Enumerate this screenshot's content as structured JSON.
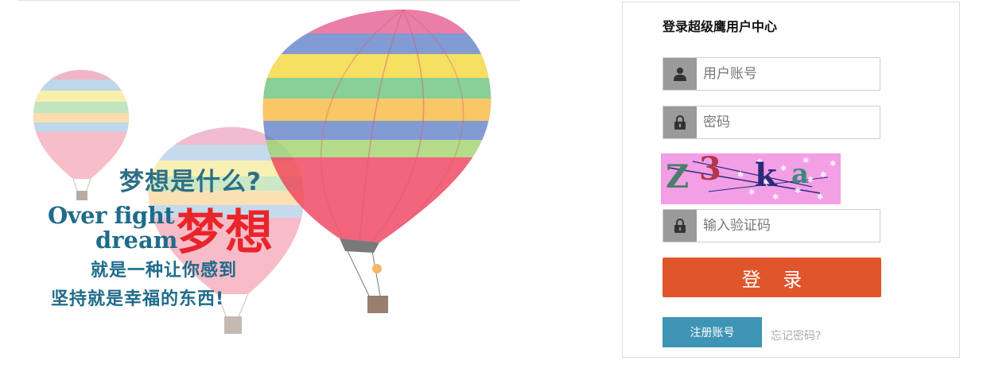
{
  "banner": {
    "question": "梦想是什么?",
    "en_line1": "Over fight",
    "en_line2": "dream",
    "dream_cn": "梦想",
    "line3": "就是一种让你感到",
    "line4": "坚持就是幸福的东西!",
    "colors": {
      "teal": "#1f6b8a",
      "red": "#e8252b"
    }
  },
  "login": {
    "title": "登录超级鹰用户中心",
    "username": {
      "placeholder": "用户账号",
      "value": "",
      "icon": "user-icon"
    },
    "password": {
      "placeholder": "密码",
      "value": "",
      "icon": "lock-icon"
    },
    "captcha": {
      "text": [
        "Z",
        "3",
        "k",
        "a"
      ]
    },
    "captcha_input": {
      "placeholder": "输入验证码",
      "value": "",
      "icon": "lock-icon"
    },
    "submit_label": "登 录",
    "register_label": "注册账号",
    "forgot_label": "忘记密码?",
    "colors": {
      "submit": "#e0552b",
      "register": "#3e94b5",
      "captcha_bg": "#f29fe6",
      "icon_bg": "#9a9a9a"
    }
  }
}
